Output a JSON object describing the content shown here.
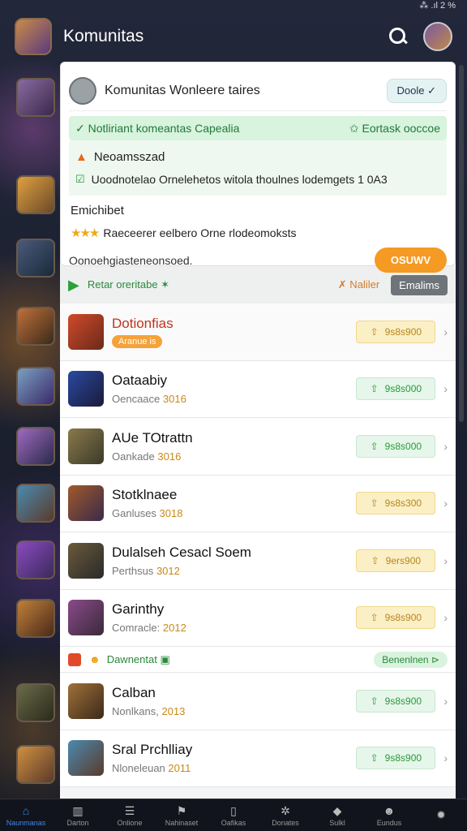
{
  "status": {
    "text": "⁂ .ıl 2 %"
  },
  "header": {
    "title": "Komunitas"
  },
  "card": {
    "title": "Komunitas Wonleere taires",
    "done_label": "Doole ✓",
    "notice_left": "✓ Notliriant komeantas Capealia",
    "notice_right": "✩ Eortask ooccoe",
    "line1": "Neoamsszad",
    "line2": "Uoodnotelao Ornelehetos witola thoulnes lodemgets 1 0A3",
    "line3": "Emichibet",
    "line4": "Raeceerer eelbero Orne rlodeomoksts",
    "footer": "Oonoehgiasteneonsoed.",
    "button": "OSUWV"
  },
  "section": {
    "left": "Retar oreritabe ✶",
    "right": "✗ Naliler",
    "button": "Emalims"
  },
  "rows": [
    {
      "name": "Dotionfias",
      "tag": "Aranue is",
      "score": "9s8s900",
      "score_color": "yellow"
    },
    {
      "name": "Oataabiy",
      "sub": "Oencaace",
      "year": "3016",
      "score": "9s8s000",
      "score_color": "green"
    },
    {
      "name": "AUe TOtrattn",
      "sub": "Oankade",
      "year": "3016",
      "score": "9s8s000",
      "score_color": "green"
    },
    {
      "name": "Stotklnaee",
      "sub": "Ganluses",
      "year": "3018",
      "score": "9s8s300",
      "score_color": "yellow"
    },
    {
      "name": "Dulalseh Cesacl Soem",
      "sub": "Perthsus",
      "year": "3012",
      "score": "9ers900",
      "score_color": "yellow"
    },
    {
      "name": "Garinthy",
      "sub": "Comracle:",
      "year": "2012",
      "score": "9s8s900",
      "score_color": "yellow"
    }
  ],
  "mini_bar": {
    "text": "Dawnentat ▣",
    "pill": "Benenlnen ⊳"
  },
  "rows2": [
    {
      "name": "Calban",
      "sub": "Nonlkans,",
      "year": "2013",
      "score": "9s8s900",
      "score_color": "green"
    },
    {
      "name": "Sral Prchlliay",
      "sub": "Nloneleuan",
      "year": "2011",
      "score": "9s8s900",
      "score_color": "green"
    }
  ],
  "nav": [
    {
      "label": "Naunmanas",
      "icon": "home-icon",
      "glyph": "⌂"
    },
    {
      "label": "Darton",
      "icon": "chart-icon",
      "glyph": "▥"
    },
    {
      "label": "Onlione",
      "icon": "list-icon",
      "glyph": "☰"
    },
    {
      "label": "Nahinaset",
      "icon": "flag-icon",
      "glyph": "⚑"
    },
    {
      "label": "Oafikas",
      "icon": "card-icon",
      "glyph": "▯"
    },
    {
      "label": "Donates",
      "icon": "gear-icon",
      "glyph": "✲"
    },
    {
      "label": "Sulkl",
      "icon": "shield-icon",
      "glyph": "◆"
    },
    {
      "label": "Eundus",
      "icon": "users-icon",
      "glyph": "☻"
    },
    {
      "label": "",
      "icon": "avatar-icon",
      "glyph": "✹"
    }
  ]
}
